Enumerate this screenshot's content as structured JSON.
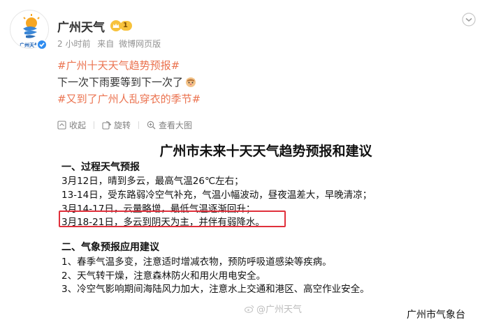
{
  "account": {
    "name": "广州天气",
    "avatar_text": "广州天气",
    "level": "1"
  },
  "meta": {
    "time": "2 小时前",
    "source_prefix": "来自",
    "source": "微博网页版"
  },
  "content": {
    "tag1": "#广州十天天气趋势预报#",
    "line2": "下一次下雨要等到下一次了",
    "tag2": "#又到了广州人乱穿衣的季节#"
  },
  "actions": {
    "collapse": "收起",
    "rotate": "旋转",
    "view_large": "查看大图"
  },
  "image": {
    "title": "广州市未来十天天气趋势预报和建议",
    "section1_title": "一、过程天气预报",
    "forecast": [
      "3月12日，晴到多云，最高气温26℃左右；",
      "13-14日，受东路弱冷空气补充，气温小幅波动，昼夜温差大，早晚清凉；",
      "3月14-17日，云量略增，最低气温逐渐回升；",
      "3月18-21日，多云到阴天为主，并伴有弱降水。"
    ],
    "section2_title": "二、气象预报应用建议",
    "advice": [
      "1、春季气温多变，注意适时增减衣物，预防呼吸道感染等疾病。",
      "2、天气转干燥，注意森林防火和用火用电安全。",
      "3、冷空气影响期间海陆风力加大，注意水上交通和港区、高空作业安全。"
    ],
    "watermark": "@广州天气",
    "signature": "广州市气象台"
  },
  "colors": {
    "tag": "#eb7350",
    "highlight_border": "#e0303b",
    "verified": "#2f8cf0"
  }
}
